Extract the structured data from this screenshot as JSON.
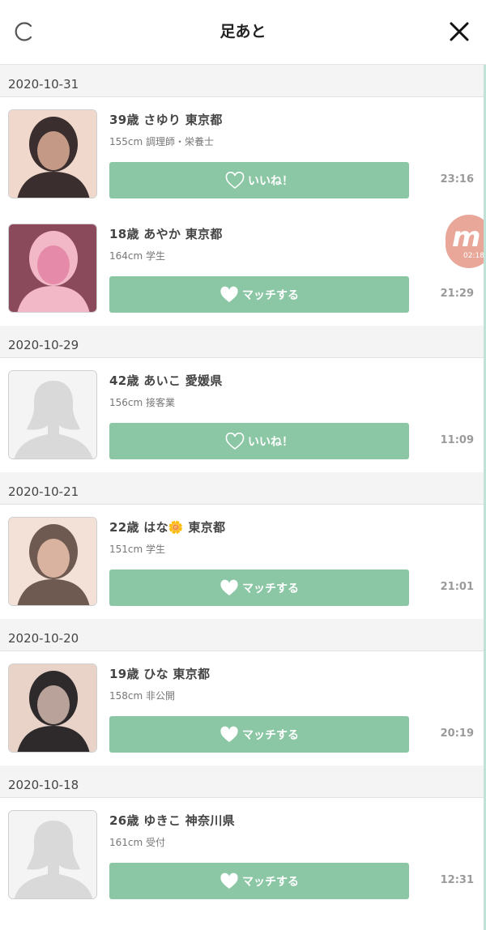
{
  "header": {
    "title": "足あと",
    "refresh_icon": "refresh-icon",
    "close_icon": "close-icon"
  },
  "colors": {
    "button": "#8bc7a4",
    "badge": "#e9a79a"
  },
  "groups": [
    {
      "date": "2020-10-31",
      "items": [
        {
          "name": "39歳 さゆり 東京都",
          "sub": "155cm 調理師・栄養士",
          "button": "いいね！",
          "button_type": "like",
          "time": "23:16",
          "avatar": "photo"
        },
        {
          "name": "18歳 あやか 東京都",
          "sub": "164cm 学生",
          "button": "マッチする",
          "button_type": "match",
          "time": "21:29",
          "avatar": "photo"
        }
      ]
    },
    {
      "date": "2020-10-29",
      "items": [
        {
          "name": "42歳 あいこ 愛媛県",
          "sub": "156cm 接客業",
          "button": "いいね！",
          "button_type": "like",
          "time": "11:09",
          "avatar": "placeholder"
        }
      ]
    },
    {
      "date": "2020-10-21",
      "items": [
        {
          "name": "22歳 はな🌼 東京都",
          "sub": "151cm 学生",
          "button": "マッチする",
          "button_type": "match",
          "time": "21:01",
          "avatar": "photo"
        }
      ]
    },
    {
      "date": "2020-10-20",
      "items": [
        {
          "name": "19歳 ひな 東京都",
          "sub": "158cm 非公開",
          "button": "マッチする",
          "button_type": "match",
          "time": "20:19",
          "avatar": "photo"
        }
      ]
    },
    {
      "date": "2020-10-18",
      "items": [
        {
          "name": "26歳 ゆきこ 神奈川県",
          "sub": "161cm 受付",
          "button": "マッチする",
          "button_type": "match",
          "time": "12:31",
          "avatar": "placeholder"
        }
      ]
    }
  ],
  "floating_badge": {
    "letter": "m",
    "time": "02:18"
  }
}
